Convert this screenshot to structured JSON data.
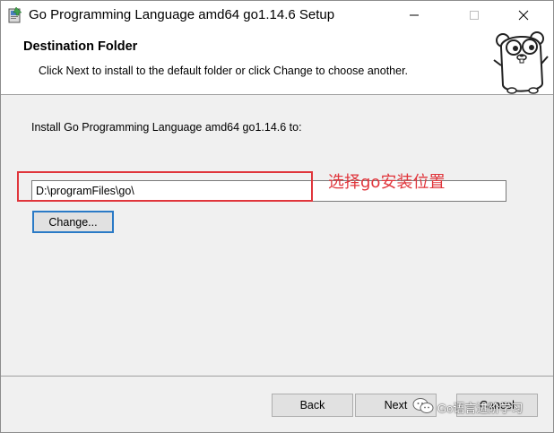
{
  "window": {
    "title": "Go Programming Language amd64 go1.14.6 Setup"
  },
  "banner": {
    "title": "Destination Folder",
    "description": "Click Next to install to the default folder or click Change to choose another."
  },
  "body": {
    "install_label": "Install Go Programming Language amd64 go1.14.6 to:",
    "path_value": "D:\\programFiles\\go\\",
    "change_label": "Change...",
    "annotation": "选择go安装位置"
  },
  "footer": {
    "back_label": "Back",
    "next_label": "Next",
    "cancel_label": "Cancel"
  },
  "watermark": {
    "text": "Go语言进阶学习"
  },
  "icons": [
    "installer-icon",
    "minimize-icon",
    "maximize-icon",
    "close-icon",
    "gopher-mascot-icon",
    "wechat-icon"
  ],
  "colors": {
    "annotation_red": "#e0353b",
    "focus_blue": "#2a7ac6",
    "window_bg": "#f0f0f0"
  }
}
